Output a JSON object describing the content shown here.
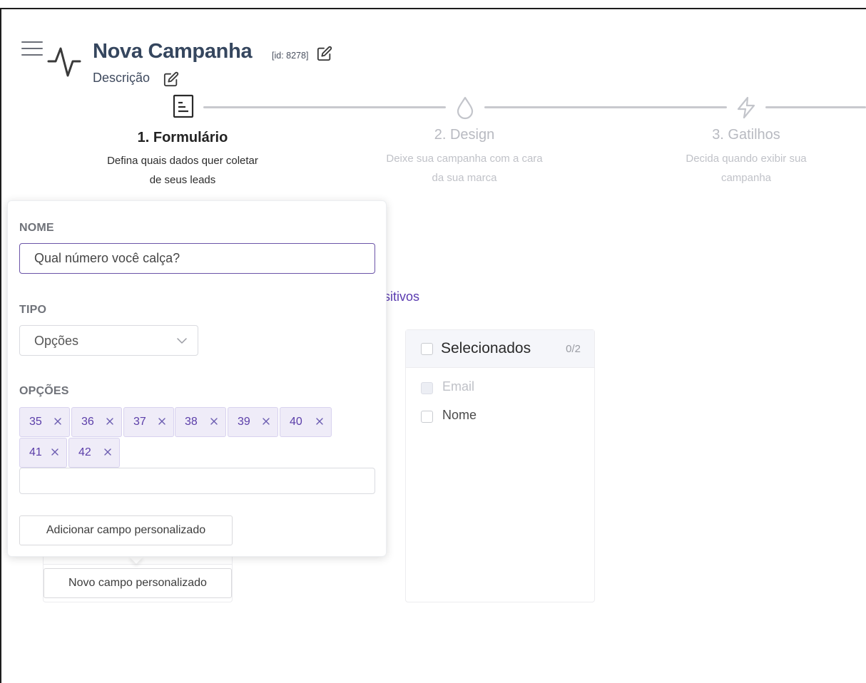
{
  "header": {
    "title": "Nova Campanha",
    "id_label": "[id: 8278]",
    "description": "Descrição"
  },
  "steps": [
    {
      "title": "1. Formulário",
      "desc": "Defina quais dados quer coletar de seus leads",
      "state": "active",
      "icon": "document-icon"
    },
    {
      "title": "2. Design",
      "desc": "Deixe sua campanha com a cara da sua marca",
      "state": "inactive",
      "icon": "droplet-icon"
    },
    {
      "title": "3. Gatilhos",
      "desc": "Decida quando exibir sua campanha",
      "state": "inactive",
      "icon": "lightning-icon"
    }
  ],
  "background": {
    "partial_link": "sitivos",
    "new_custom_field_button": "Novo campo personalizado",
    "selected_panel": {
      "title": "Selecionados",
      "count": "0/2",
      "items": [
        {
          "label": "Email",
          "disabled": true
        },
        {
          "label": "Nome",
          "disabled": false
        }
      ]
    }
  },
  "popover": {
    "name_label": "NOME",
    "name_value": "Qual número você calça?",
    "type_label": "TIPO",
    "type_value": "Opções",
    "options_label": "OPÇÕES",
    "options": [
      "35",
      "36",
      "37",
      "38",
      "39",
      "40",
      "41",
      "42"
    ],
    "options_input_value": "",
    "add_button": "Adicionar campo personalizado"
  },
  "colors": {
    "title": "#35465e",
    "accent_purple": "#5b3ea9",
    "tag_bg": "#efecf8",
    "inactive_step": "#b8bac1"
  }
}
